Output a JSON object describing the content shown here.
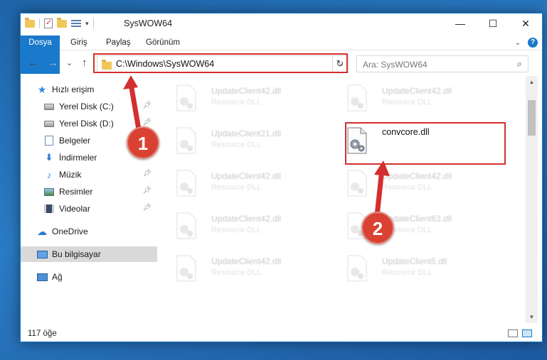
{
  "window": {
    "title": "SysWOW64",
    "quick_access_dropdown": "▾",
    "controls": {
      "minimize": "—",
      "maximize": "☐",
      "close": "✕"
    }
  },
  "ribbon": {
    "tabs": [
      {
        "label": "Dosya",
        "active": true
      },
      {
        "label": "Giriş"
      },
      {
        "label": "Paylaş"
      },
      {
        "label": "Görünüm"
      }
    ],
    "help_label": "?"
  },
  "navbar": {
    "back": "←",
    "forward": "→",
    "recent": "⌄",
    "up": "↑",
    "address": "C:\\Windows\\SysWOW64",
    "address_dropdown": "⌄",
    "refresh": "↻",
    "search_placeholder": "Ara: SysWOW64",
    "search_icon": "search-icon"
  },
  "navpane": {
    "items": [
      {
        "label": "Hızlı erişim",
        "icon": "star-icon"
      },
      {
        "label": "Yerel Disk (C:)",
        "icon": "drive-icon",
        "pinned": true
      },
      {
        "label": "Yerel Disk (D:)",
        "icon": "drive-icon",
        "pinned": true
      },
      {
        "label": "Belgeler",
        "icon": "documents-icon",
        "pinned": true
      },
      {
        "label": "İndirmeler",
        "icon": "download-icon",
        "pinned": true
      },
      {
        "label": "Müzik",
        "icon": "music-icon",
        "pinned": true
      },
      {
        "label": "Resimler",
        "icon": "pictures-icon",
        "pinned": true
      },
      {
        "label": "Videolar",
        "icon": "video-icon",
        "pinned": true
      },
      {
        "label": "OneDrive",
        "icon": "cloud-icon"
      },
      {
        "label": "Bu bilgisayar",
        "icon": "computer-icon",
        "selected": true
      },
      {
        "label": "Ağ",
        "icon": "network-icon"
      }
    ]
  },
  "files": [
    {
      "name": "UpdateClient42.dll",
      "desc": "Resource DLL",
      "faded": true
    },
    {
      "name": "UpdateClient42.dll",
      "desc": "Resource DLL",
      "faded": true
    },
    {
      "name": "UpdateClient21.dll",
      "desc": "Resource DLL",
      "faded": true
    },
    {
      "name": "convcore.dll",
      "desc": "",
      "faded": false,
      "highlighted": true
    },
    {
      "name": "UpdateClient42.dll",
      "desc": "Resource DLL",
      "faded": true
    },
    {
      "name": "UpdateClient42.dll",
      "desc": "Resource DLL",
      "faded": true
    },
    {
      "name": "UpdateClient42.dll",
      "desc": "Resource DLL",
      "faded": true
    },
    {
      "name": "UpdateClient63.dll",
      "desc": "Resource DLL",
      "faded": true
    },
    {
      "name": "UpdateClient42.dll",
      "desc": "Resource DLL",
      "faded": true
    },
    {
      "name": "UpdateClient5.dll",
      "desc": "Resource DLL",
      "faded": true
    }
  ],
  "status": {
    "count": "117 öğe"
  },
  "annotations": {
    "badge1": "1",
    "badge2": "2",
    "color": "#d32f2f"
  },
  "colors": {
    "accent": "#1979ca",
    "annotation": "#d32f2f",
    "badge": "#d94133"
  }
}
